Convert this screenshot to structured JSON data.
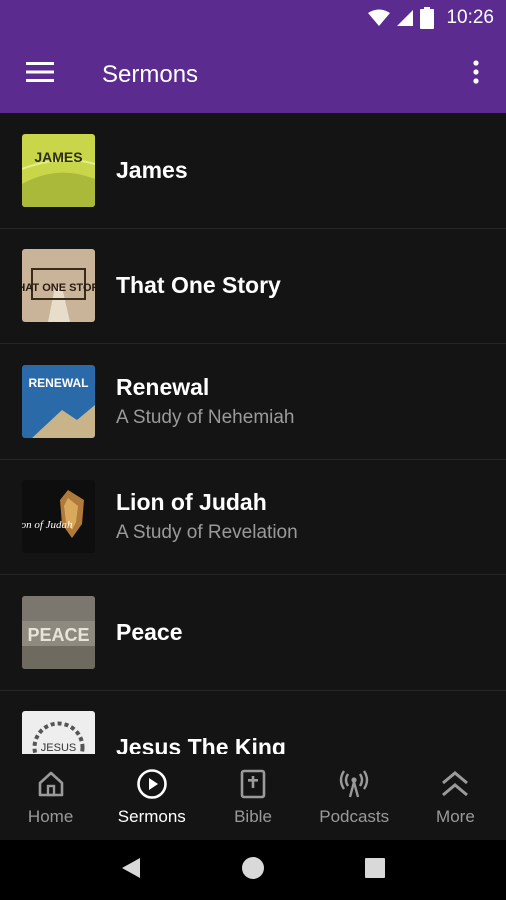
{
  "status_bar": {
    "time": "10:26"
  },
  "app_bar": {
    "title": "Sermons"
  },
  "sermons": [
    {
      "title": "James",
      "subtitle": "",
      "thumb_text": "JAMES"
    },
    {
      "title": "That One Story",
      "subtitle": "",
      "thumb_text": "THAT ONE STORY"
    },
    {
      "title": "Renewal",
      "subtitle": "A Study of Nehemiah",
      "thumb_text": "RENEWAL"
    },
    {
      "title": "Lion of Judah",
      "subtitle": "A Study of Revelation",
      "thumb_text": "Lion of Judah"
    },
    {
      "title": "Peace",
      "subtitle": "",
      "thumb_text": "PEACE"
    },
    {
      "title": "Jesus The King",
      "subtitle": "",
      "thumb_text": "JESUS"
    }
  ],
  "bottom_nav": [
    {
      "label": "Home",
      "icon": "home-icon"
    },
    {
      "label": "Sermons",
      "icon": "play-circle-icon",
      "active": true
    },
    {
      "label": "Bible",
      "icon": "bible-icon"
    },
    {
      "label": "Podcasts",
      "icon": "podcast-icon"
    },
    {
      "label": "More",
      "icon": "chevron-up-double-icon"
    }
  ],
  "colors": {
    "primary": "#5b2b8f",
    "background": "#141414",
    "inactive": "#9a9a9a"
  }
}
